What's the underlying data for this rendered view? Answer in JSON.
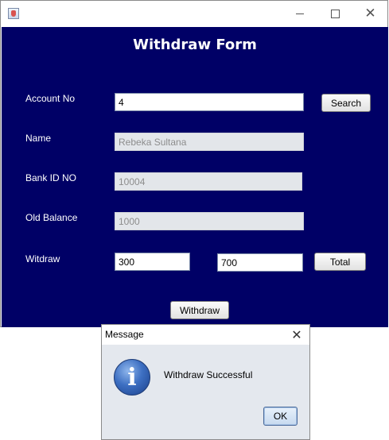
{
  "window": {
    "title": "",
    "app_icon": "java-cup-icon"
  },
  "form": {
    "title": "Withdraw Form",
    "account_no_label": "Account No",
    "account_no_value": "4",
    "search_label": "Search",
    "name_label": "Name",
    "name_value": "Rebeka Sultana",
    "bank_id_label": "Bank ID NO",
    "bank_id_value": "10004",
    "old_balance_label": "Old Balance",
    "old_balance_value": "1000",
    "withdraw_label": "Witdraw",
    "withdraw_amount_value": "300",
    "total_value": "700",
    "total_label": "Total",
    "withdraw_button_label": "Withdraw"
  },
  "colors": {
    "form_background": "#000066",
    "dialog_background": "#e4e8ee"
  },
  "dialog": {
    "title": "Message",
    "icon": "info-icon",
    "message": "Withdraw Successful",
    "ok_label": "OK"
  }
}
